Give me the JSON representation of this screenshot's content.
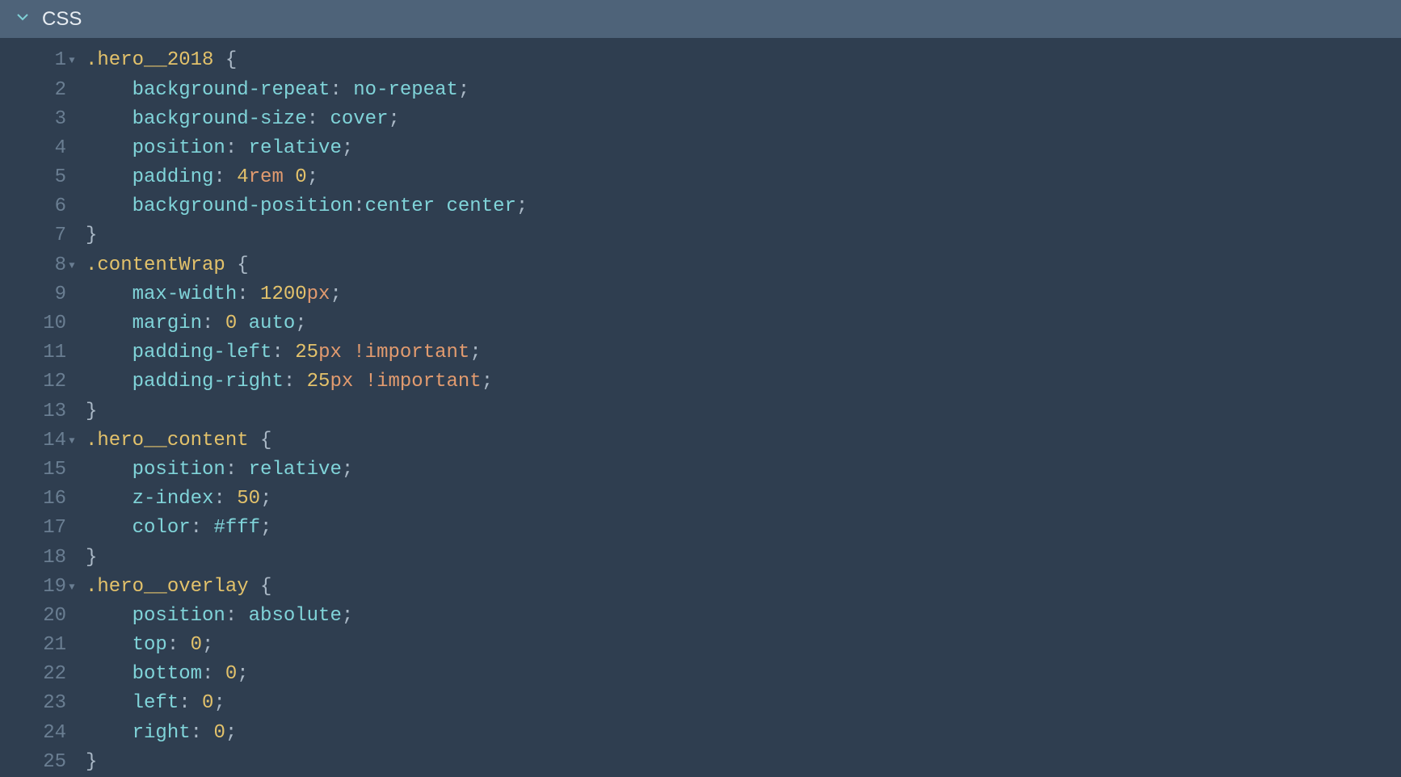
{
  "header": {
    "title": "CSS"
  },
  "lines": [
    {
      "num": "1",
      "fold": true,
      "tokens": [
        {
          "c": "sel",
          "t": ".hero__2018 "
        },
        {
          "c": "brace",
          "t": "{"
        }
      ]
    },
    {
      "num": "2",
      "fold": false,
      "tokens": [
        {
          "c": "default",
          "t": "    "
        },
        {
          "c": "prop",
          "t": "background-repeat"
        },
        {
          "c": "colon",
          "t": ": "
        },
        {
          "c": "val",
          "t": "no-repeat"
        },
        {
          "c": "semi",
          "t": ";"
        }
      ]
    },
    {
      "num": "3",
      "fold": false,
      "tokens": [
        {
          "c": "default",
          "t": "    "
        },
        {
          "c": "prop",
          "t": "background-size"
        },
        {
          "c": "colon",
          "t": ": "
        },
        {
          "c": "val",
          "t": "cover"
        },
        {
          "c": "semi",
          "t": ";"
        }
      ]
    },
    {
      "num": "4",
      "fold": false,
      "tokens": [
        {
          "c": "default",
          "t": "    "
        },
        {
          "c": "prop",
          "t": "position"
        },
        {
          "c": "colon",
          "t": ": "
        },
        {
          "c": "val",
          "t": "relative"
        },
        {
          "c": "semi",
          "t": ";"
        }
      ]
    },
    {
      "num": "5",
      "fold": false,
      "tokens": [
        {
          "c": "default",
          "t": "    "
        },
        {
          "c": "prop",
          "t": "padding"
        },
        {
          "c": "colon",
          "t": ": "
        },
        {
          "c": "num",
          "t": "4"
        },
        {
          "c": "unit",
          "t": "rem"
        },
        {
          "c": "default",
          "t": " "
        },
        {
          "c": "num",
          "t": "0"
        },
        {
          "c": "semi",
          "t": ";"
        }
      ]
    },
    {
      "num": "6",
      "fold": false,
      "tokens": [
        {
          "c": "default",
          "t": "    "
        },
        {
          "c": "prop",
          "t": "background-position"
        },
        {
          "c": "colon",
          "t": ":"
        },
        {
          "c": "val",
          "t": "center"
        },
        {
          "c": "default",
          "t": " "
        },
        {
          "c": "val",
          "t": "center"
        },
        {
          "c": "semi",
          "t": ";"
        }
      ]
    },
    {
      "num": "7",
      "fold": false,
      "tokens": [
        {
          "c": "brace",
          "t": "}"
        }
      ]
    },
    {
      "num": "8",
      "fold": true,
      "tokens": [
        {
          "c": "sel",
          "t": ".contentWrap "
        },
        {
          "c": "brace",
          "t": "{"
        }
      ]
    },
    {
      "num": "9",
      "fold": false,
      "tokens": [
        {
          "c": "default",
          "t": "    "
        },
        {
          "c": "prop",
          "t": "max-width"
        },
        {
          "c": "colon",
          "t": ": "
        },
        {
          "c": "num",
          "t": "1200"
        },
        {
          "c": "unit",
          "t": "px"
        },
        {
          "c": "semi",
          "t": ";"
        }
      ]
    },
    {
      "num": "10",
      "fold": false,
      "tokens": [
        {
          "c": "default",
          "t": "    "
        },
        {
          "c": "prop",
          "t": "margin"
        },
        {
          "c": "colon",
          "t": ": "
        },
        {
          "c": "num",
          "t": "0"
        },
        {
          "c": "default",
          "t": " "
        },
        {
          "c": "val",
          "t": "auto"
        },
        {
          "c": "semi",
          "t": ";"
        }
      ]
    },
    {
      "num": "11",
      "fold": false,
      "tokens": [
        {
          "c": "default",
          "t": "    "
        },
        {
          "c": "prop",
          "t": "padding-left"
        },
        {
          "c": "colon",
          "t": ": "
        },
        {
          "c": "num",
          "t": "25"
        },
        {
          "c": "unit",
          "t": "px"
        },
        {
          "c": "default",
          "t": " "
        },
        {
          "c": "imp",
          "t": "!important"
        },
        {
          "c": "semi",
          "t": ";"
        }
      ]
    },
    {
      "num": "12",
      "fold": false,
      "tokens": [
        {
          "c": "default",
          "t": "    "
        },
        {
          "c": "prop",
          "t": "padding-right"
        },
        {
          "c": "colon",
          "t": ": "
        },
        {
          "c": "num",
          "t": "25"
        },
        {
          "c": "unit",
          "t": "px"
        },
        {
          "c": "default",
          "t": " "
        },
        {
          "c": "imp",
          "t": "!important"
        },
        {
          "c": "semi",
          "t": ";"
        }
      ]
    },
    {
      "num": "13",
      "fold": false,
      "tokens": [
        {
          "c": "brace",
          "t": "}"
        }
      ]
    },
    {
      "num": "14",
      "fold": true,
      "tokens": [
        {
          "c": "sel",
          "t": ".hero__content "
        },
        {
          "c": "brace",
          "t": "{"
        }
      ]
    },
    {
      "num": "15",
      "fold": false,
      "tokens": [
        {
          "c": "default",
          "t": "    "
        },
        {
          "c": "prop",
          "t": "position"
        },
        {
          "c": "colon",
          "t": ": "
        },
        {
          "c": "val",
          "t": "relative"
        },
        {
          "c": "semi",
          "t": ";"
        }
      ]
    },
    {
      "num": "16",
      "fold": false,
      "tokens": [
        {
          "c": "default",
          "t": "    "
        },
        {
          "c": "prop",
          "t": "z-index"
        },
        {
          "c": "colon",
          "t": ": "
        },
        {
          "c": "num",
          "t": "50"
        },
        {
          "c": "semi",
          "t": ";"
        }
      ]
    },
    {
      "num": "17",
      "fold": false,
      "tokens": [
        {
          "c": "default",
          "t": "    "
        },
        {
          "c": "prop",
          "t": "color"
        },
        {
          "c": "colon",
          "t": ": "
        },
        {
          "c": "val",
          "t": "#fff"
        },
        {
          "c": "semi",
          "t": ";"
        }
      ]
    },
    {
      "num": "18",
      "fold": false,
      "tokens": [
        {
          "c": "brace",
          "t": "}"
        }
      ]
    },
    {
      "num": "19",
      "fold": true,
      "tokens": [
        {
          "c": "sel",
          "t": ".hero__overlay "
        },
        {
          "c": "brace",
          "t": "{"
        }
      ]
    },
    {
      "num": "20",
      "fold": false,
      "tokens": [
        {
          "c": "default",
          "t": "    "
        },
        {
          "c": "prop",
          "t": "position"
        },
        {
          "c": "colon",
          "t": ": "
        },
        {
          "c": "val",
          "t": "absolute"
        },
        {
          "c": "semi",
          "t": ";"
        }
      ]
    },
    {
      "num": "21",
      "fold": false,
      "tokens": [
        {
          "c": "default",
          "t": "    "
        },
        {
          "c": "prop",
          "t": "top"
        },
        {
          "c": "colon",
          "t": ": "
        },
        {
          "c": "num",
          "t": "0"
        },
        {
          "c": "semi",
          "t": ";"
        }
      ]
    },
    {
      "num": "22",
      "fold": false,
      "tokens": [
        {
          "c": "default",
          "t": "    "
        },
        {
          "c": "prop",
          "t": "bottom"
        },
        {
          "c": "colon",
          "t": ": "
        },
        {
          "c": "num",
          "t": "0"
        },
        {
          "c": "semi",
          "t": ";"
        }
      ]
    },
    {
      "num": "23",
      "fold": false,
      "tokens": [
        {
          "c": "default",
          "t": "    "
        },
        {
          "c": "prop",
          "t": "left"
        },
        {
          "c": "colon",
          "t": ": "
        },
        {
          "c": "num",
          "t": "0"
        },
        {
          "c": "semi",
          "t": ";"
        }
      ]
    },
    {
      "num": "24",
      "fold": false,
      "tokens": [
        {
          "c": "default",
          "t": "    "
        },
        {
          "c": "prop",
          "t": "right"
        },
        {
          "c": "colon",
          "t": ": "
        },
        {
          "c": "num",
          "t": "0"
        },
        {
          "c": "semi",
          "t": ";"
        }
      ]
    },
    {
      "num": "25",
      "fold": false,
      "tokens": [
        {
          "c": "brace",
          "t": "}"
        }
      ]
    }
  ]
}
